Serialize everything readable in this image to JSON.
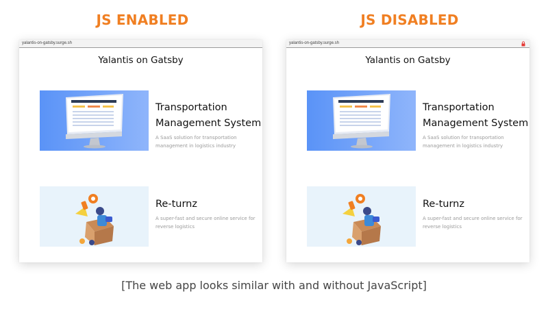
{
  "headings": {
    "left": "JS ENABLED",
    "right": "JS DISABLED"
  },
  "browser": {
    "url": "yalantis-on-gatsby.surge.sh"
  },
  "site": {
    "title": "Yalantis on Gatsby"
  },
  "cards": [
    {
      "title": "Transportation Management System",
      "description": "A SaaS solution for transportation management in logistics industry"
    },
    {
      "title": "Re-turnz",
      "description": "A super-fast and secure online service for reverse logistics"
    }
  ],
  "caption": "[The web app looks similar with and without JavaScript]",
  "colors": {
    "heading": "#f07f22",
    "tms_bg": "#5a93f7",
    "returnz_bg": "#e8f3fb",
    "lock": "#e53935"
  },
  "icons": {
    "disabled_indicator": "lock-icon"
  }
}
